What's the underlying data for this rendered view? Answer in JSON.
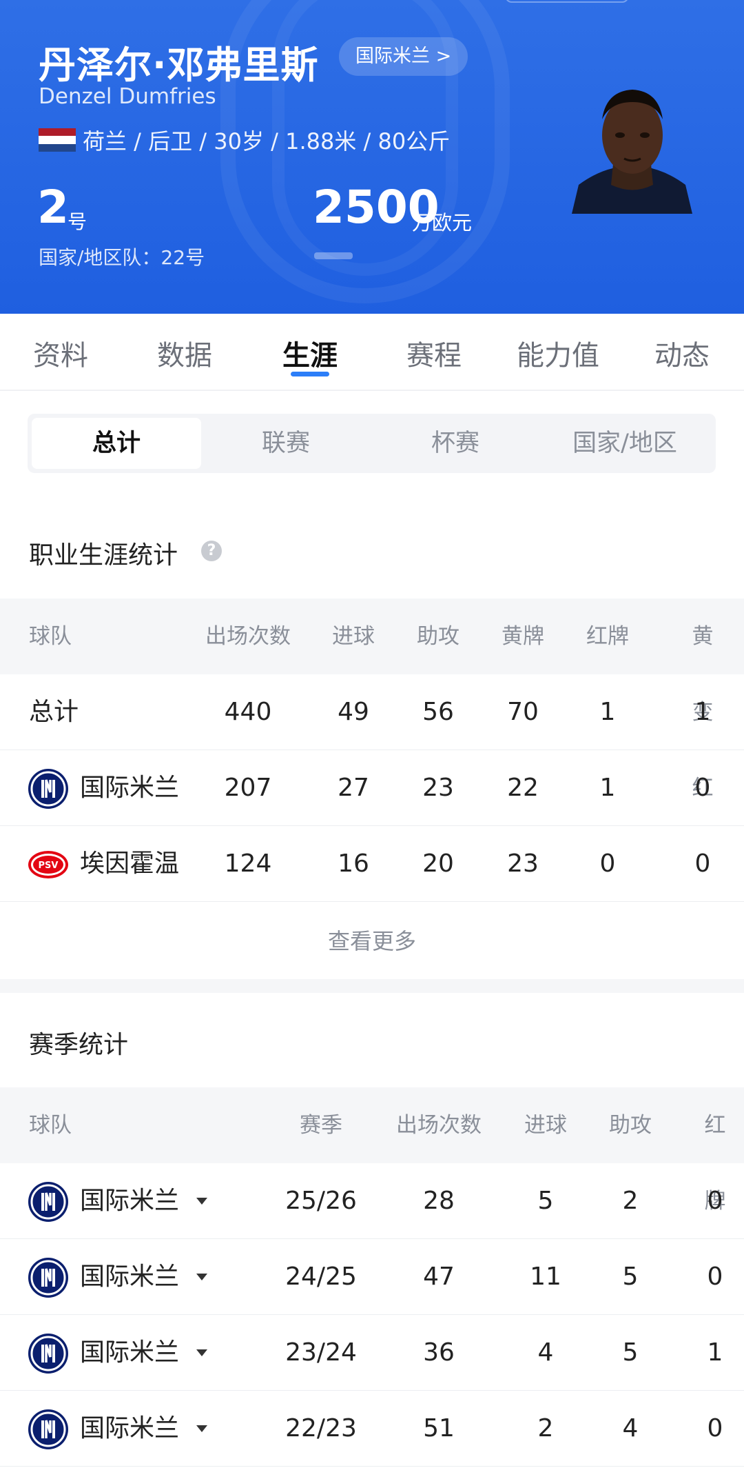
{
  "player": {
    "name_cn": "丹泽尔·邓弗里斯",
    "club_pill": "国际米兰 >",
    "name_en": "Denzel Dumfries",
    "bio": "荷兰 / 后卫 / 30岁 / 1.88米 / 80公斤",
    "shirt_number": "2",
    "shirt_unit": "号",
    "national_team": "国家/地区队：22号",
    "market_value": "2500",
    "market_value_unit": "万欧元",
    "flag_colors": [
      "#ae1c28",
      "#ffffff",
      "#21468b"
    ]
  },
  "tabs": [
    "资料",
    "数据",
    "生涯",
    "赛程",
    "能力值",
    "动态"
  ],
  "active_tab": "生涯",
  "segments": [
    "总计",
    "联赛",
    "杯赛",
    "国家/地区"
  ],
  "career": {
    "title": "职业生涯统计",
    "headers": [
      "球队",
      "出场次数",
      "进球",
      "助攻",
      "黄牌",
      "红牌",
      "黄变红"
    ],
    "rows": [
      {
        "team": "总计",
        "logo": "",
        "values": [
          "440",
          "49",
          "56",
          "70",
          "1",
          "1"
        ]
      },
      {
        "team": "国际米兰",
        "logo": "inter-logo",
        "values": [
          "207",
          "27",
          "23",
          "22",
          "1",
          "0"
        ]
      },
      {
        "team": "埃因霍温",
        "logo": "psv-logo",
        "values": [
          "124",
          "16",
          "20",
          "23",
          "0",
          "0"
        ]
      }
    ],
    "more_label": "查看更多"
  },
  "season": {
    "title": "赛季统计",
    "headers": [
      "球队",
      "赛季",
      "出场次数",
      "进球",
      "助攻",
      "红牌"
    ],
    "rows": [
      {
        "team": "国际米兰",
        "season": "25/26",
        "values": [
          "28",
          "5",
          "2",
          "0"
        ]
      },
      {
        "team": "国际米兰",
        "season": "24/25",
        "values": [
          "47",
          "11",
          "5",
          "0"
        ]
      },
      {
        "team": "国际米兰",
        "season": "23/24",
        "values": [
          "36",
          "4",
          "5",
          "1"
        ]
      },
      {
        "team": "国际米兰",
        "season": "22/23",
        "values": [
          "51",
          "2",
          "4",
          "0"
        ]
      }
    ]
  },
  "colors": {
    "header_blue": "#2666e3",
    "accent_blue": "#2c7ef8",
    "inter_navy": "#0b1f6e"
  }
}
